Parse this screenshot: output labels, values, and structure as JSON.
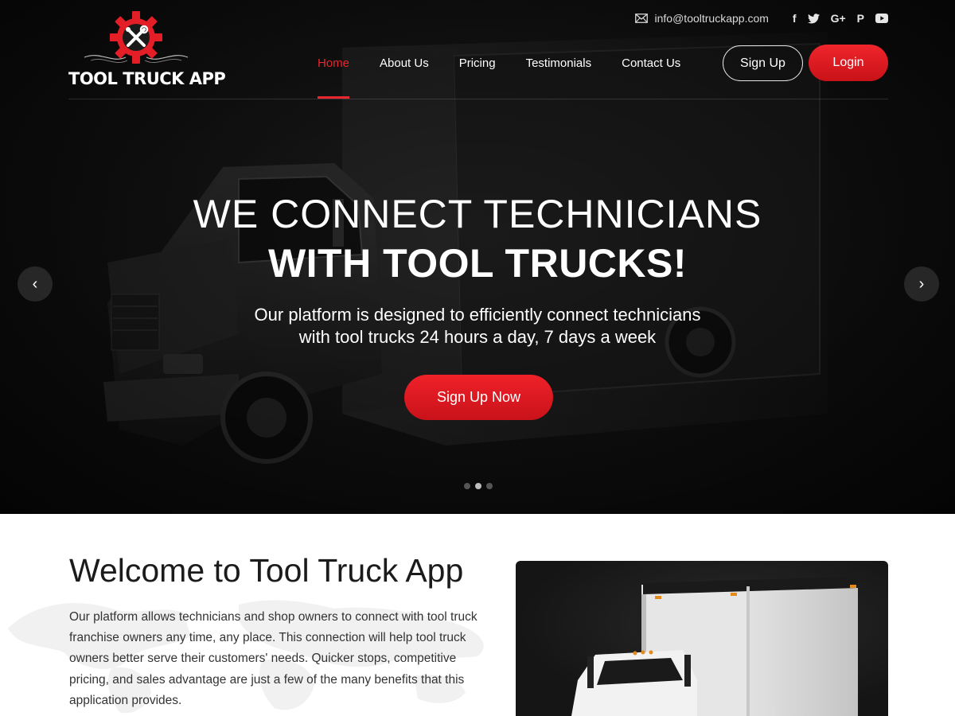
{
  "topbar": {
    "email": "info@tooltruckapp.com",
    "socials": [
      {
        "icon": "facebook-icon",
        "glyph": "f"
      },
      {
        "icon": "twitter-icon",
        "glyph": "🐦"
      },
      {
        "icon": "google-plus-icon",
        "glyph": "G+"
      },
      {
        "icon": "pinterest-icon",
        "glyph": "P"
      },
      {
        "icon": "youtube-icon",
        "glyph": "▶"
      }
    ]
  },
  "brand": {
    "logo_text": "TOOL TRUCK APP",
    "accent_color": "#e8262d"
  },
  "nav": {
    "items": [
      {
        "label": "Home",
        "active": true
      },
      {
        "label": "About Us",
        "active": false
      },
      {
        "label": "Pricing",
        "active": false
      },
      {
        "label": "Testimonials",
        "active": false
      },
      {
        "label": "Contact Us",
        "active": false
      }
    ],
    "signup_label": "Sign Up",
    "login_label": "Login"
  },
  "hero": {
    "title_line1": "WE CONNECT TECHNICIANS",
    "title_line2": "WITH TOOL TRUCKS!",
    "subtitle_line1": "Our platform is designed to efficiently connect technicians",
    "subtitle_line2": "with tool trucks 24 hours a day, 7 days a week",
    "cta_label": "Sign Up Now",
    "prev_glyph": "‹",
    "next_glyph": "›",
    "slides_total": 3,
    "slide_active": 2
  },
  "welcome": {
    "title": "Welcome to Tool Truck App",
    "body": "Our platform allows technicians and shop owners to connect with tool truck franchise owners any time, any place. This connection will help tool truck owners better serve their customers' needs. Quicker stops, competitive pricing, and sales advantage are just a few of the many benefits that this application provides."
  }
}
